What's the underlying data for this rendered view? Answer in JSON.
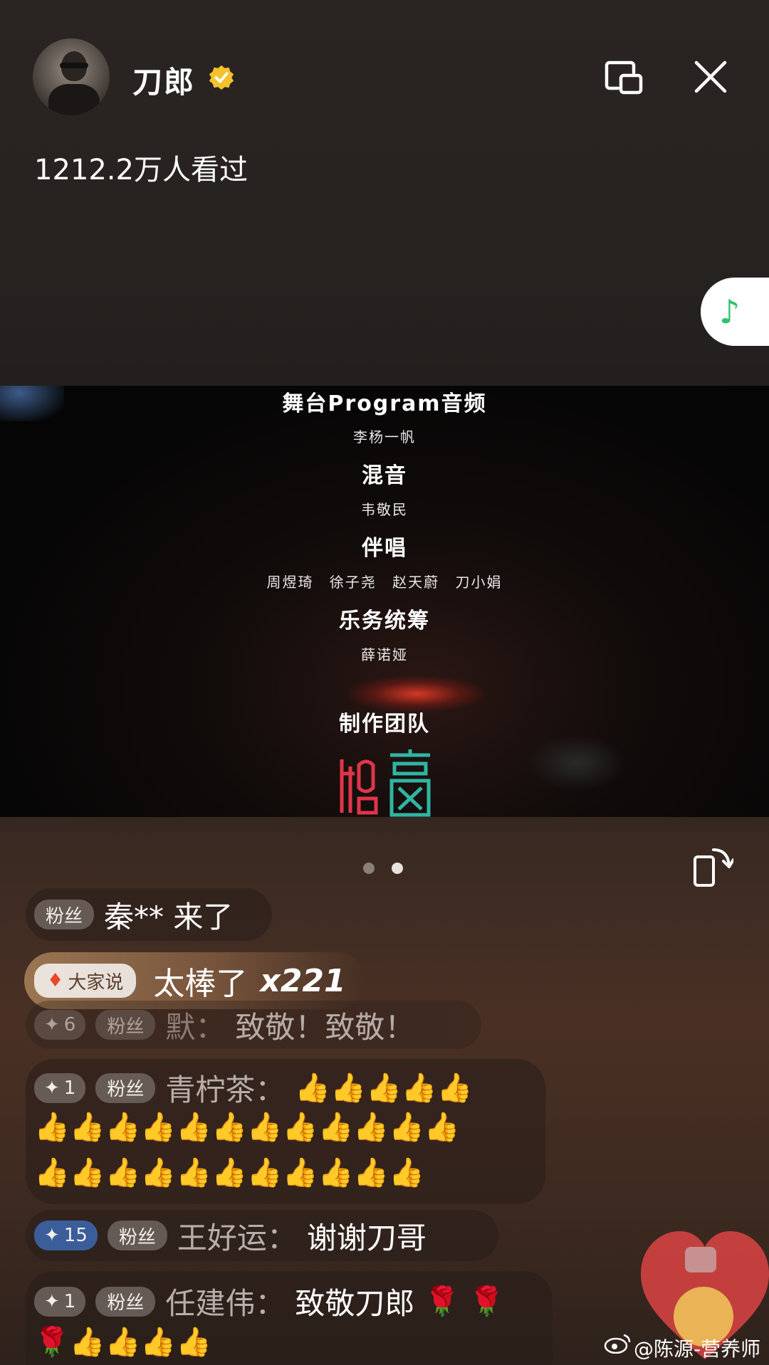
{
  "header": {
    "username": "刀郎",
    "viewers": "1212.2万人看过"
  },
  "video": {
    "credits": [
      {
        "role": "舞台Program音频",
        "names": "李杨一帆"
      },
      {
        "role": "混音",
        "names": "韦敬民"
      },
      {
        "role": "伴唱",
        "names": "周煜琦 徐子尧 赵天蔚 刀小娟"
      },
      {
        "role": "乐务统筹",
        "names": "薛诺娅"
      },
      {
        "role": "制作团队",
        "names": ""
      }
    ]
  },
  "pager": {
    "count": 2,
    "active_index": 1
  },
  "chat": {
    "entrance": {
      "badge": "粉丝",
      "text": "秦** 来了"
    },
    "highlight": {
      "badge": "大家说",
      "text": "太棒了",
      "count": "x221"
    },
    "messages": [
      {
        "level": "6",
        "badge": "粉丝",
        "name": "默：",
        "text": "致敬！致敬！"
      },
      {
        "level": "1",
        "badge": "粉丝",
        "name": "青柠茶：",
        "text": "",
        "thumbs_line1": "👍👍👍👍👍",
        "thumbs_line2": "👍👍👍👍👍👍👍👍👍👍👍👍",
        "thumbs_line3": "👍👍👍👍👍👍👍👍👍👍👍"
      },
      {
        "level": "15",
        "badge": "粉丝",
        "name": "王好运：",
        "text": "谢谢刀哥"
      },
      {
        "level": "1",
        "badge": "粉丝",
        "name": "任建伟：",
        "text": "致敬刀郎",
        "emoji_line1": "🌹 🌹",
        "emoji_line2": "🌹👍👍👍👍"
      }
    ]
  },
  "watermark": "@陈源-营养师",
  "colors": {
    "music_icon": "#2bc36b",
    "verified": "#f5c22b",
    "level_blue": "#3b5d9a"
  }
}
